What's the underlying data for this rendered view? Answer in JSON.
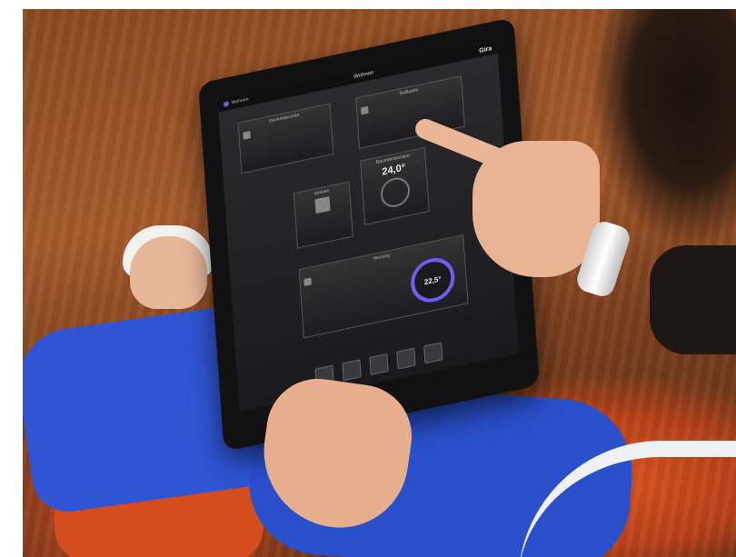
{
  "ipad_screen": {
    "brand": "Gira",
    "title": "Wohnen",
    "subtitle": "Wohnen",
    "tiles": [
      {
        "label": "Deckenleuchte",
        "value": ""
      },
      {
        "label": "Rollladen",
        "value": ""
      },
      {
        "label": "Raumtemperatur",
        "value": "24,0°"
      },
      {
        "label": "Szenen",
        "value": ""
      },
      {
        "label": "Heizung",
        "value": "22,5°"
      }
    ],
    "dock_items": [
      "home",
      "folder",
      "grid",
      "thermometer",
      "list"
    ]
  }
}
